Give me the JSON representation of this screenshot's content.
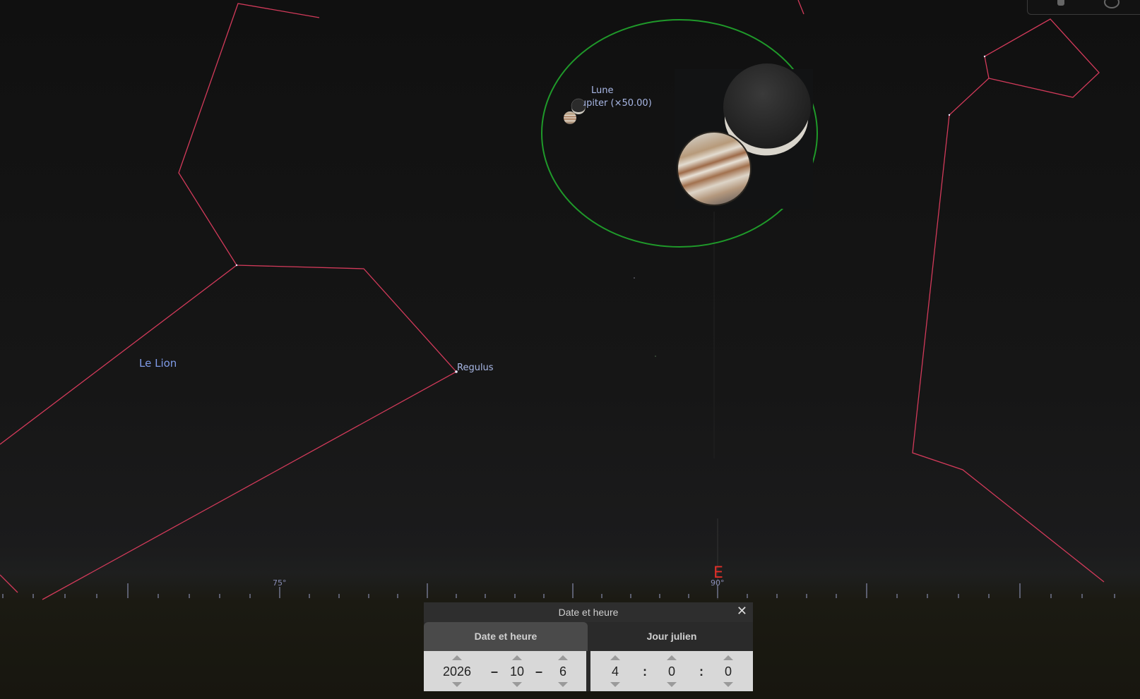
{
  "sky": {
    "constellation_name": "Le Lion",
    "star_name": "Regulus",
    "moon_label": "Lune",
    "jupiter_label": "Jupiter (×50.00)",
    "degree_labels": [
      "75°",
      "90°"
    ],
    "cardinal": "E"
  },
  "colors": {
    "constellation_line": "#d23a5a",
    "selection_circle": "#1f9a2a",
    "label": "#a9b8e6",
    "cardinal": "#e0302a"
  },
  "dialog": {
    "title": "Date et heure",
    "close_icon": "close-icon",
    "tabs": [
      {
        "label": "Date et heure",
        "active": true
      },
      {
        "label": "Jour julien",
        "active": false
      }
    ],
    "date": {
      "year": "2026",
      "month": "10",
      "day": "6",
      "separator": "–"
    },
    "time": {
      "hour": "4",
      "minute": "0",
      "second": "0",
      "separator": ":"
    }
  }
}
